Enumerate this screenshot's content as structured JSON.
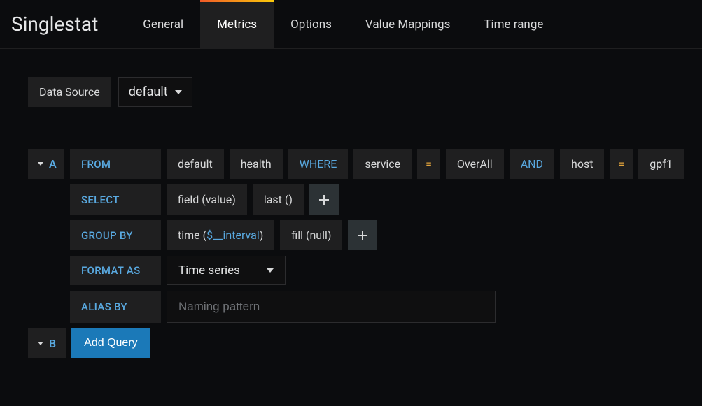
{
  "header": {
    "title": "Singlestat",
    "tabs": [
      {
        "label": "General",
        "active": false
      },
      {
        "label": "Metrics",
        "active": true
      },
      {
        "label": "Options",
        "active": false
      },
      {
        "label": "Value Mappings",
        "active": false
      },
      {
        "label": "Time range",
        "active": false
      }
    ]
  },
  "dataSource": {
    "label": "Data Source",
    "selected": "default"
  },
  "queryA": {
    "letter": "A",
    "from": {
      "keyword": "FROM",
      "policy": "default",
      "measurement": "health"
    },
    "where": {
      "keyword": "WHERE",
      "clauses": [
        {
          "key": "service",
          "op": "=",
          "value": "OverAll"
        },
        {
          "conj": "AND",
          "key": "host",
          "op": "=",
          "value": "gpf1"
        }
      ]
    },
    "select": {
      "keyword": "SELECT",
      "field_label": "field (value)",
      "agg_label": "last ()"
    },
    "groupBy": {
      "keyword": "GROUP BY",
      "time_prefix": "time (",
      "time_var": "$__interval",
      "time_suffix": ")",
      "fill_label": "fill (null)"
    },
    "formatAs": {
      "keyword": "FORMAT AS",
      "selected": "Time series"
    },
    "aliasBy": {
      "keyword": "ALIAS BY",
      "placeholder": "Naming pattern",
      "value": ""
    }
  },
  "queryB": {
    "letter": "B",
    "addQueryLabel": "Add Query"
  },
  "icons": {
    "plus": "plus-icon",
    "caret": "caret-down-icon"
  }
}
